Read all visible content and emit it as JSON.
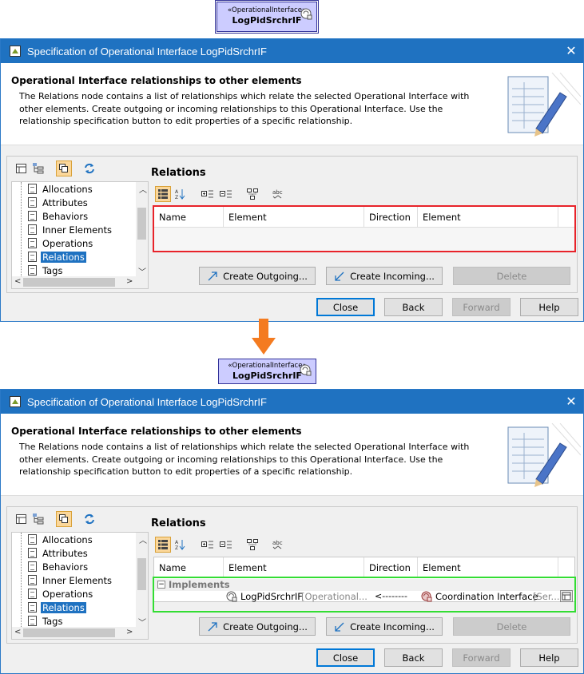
{
  "top_node": {
    "stereotype": "«OperationalInterface»",
    "name": "LogPidSrchrIF"
  },
  "bottom_node": {
    "stereotype": "«OperationalInterface»",
    "name": "LogPidSrchrIF"
  },
  "dialog": {
    "title": "Specification of Operational Interface LogPidSrchrIF",
    "close_glyph": "✕",
    "header_title": "Operational Interface relationships to other elements",
    "header_desc": "The Relations node contains a list of relationships which relate the selected Operational Interface with other elements. Create outgoing or incoming relationships to this Operational Interface. Use the relationship specification button to edit properties of a specific relationship.",
    "tree_items": [
      "Allocations",
      "Attributes",
      "Behaviors",
      "Inner Elements",
      "Operations",
      "Relations",
      "Tags"
    ],
    "selected_tree_item": "Relations",
    "panel_title": "Relations",
    "columns": [
      "Name",
      "Element",
      "Direction",
      "Element"
    ],
    "group_label": "Implements",
    "row": {
      "source_name": "LogPidSrchrIF",
      "source_type": "[Operational...",
      "direction": "<--------",
      "target_name": "Coordination Interface",
      "target_type": "[Ser..."
    },
    "buttons": {
      "create_outgoing": "Create Outgoing...",
      "create_incoming": "Create Incoming...",
      "delete": "Delete",
      "close": "Close",
      "back": "Back",
      "forward": "Forward",
      "help": "Help"
    }
  },
  "colors": {
    "title_bar": "#1f72c1",
    "node_fill": "#ccccff",
    "before_highlight": "#e8232a",
    "after_highlight": "#33dd33",
    "arrow": "#f47b20"
  }
}
